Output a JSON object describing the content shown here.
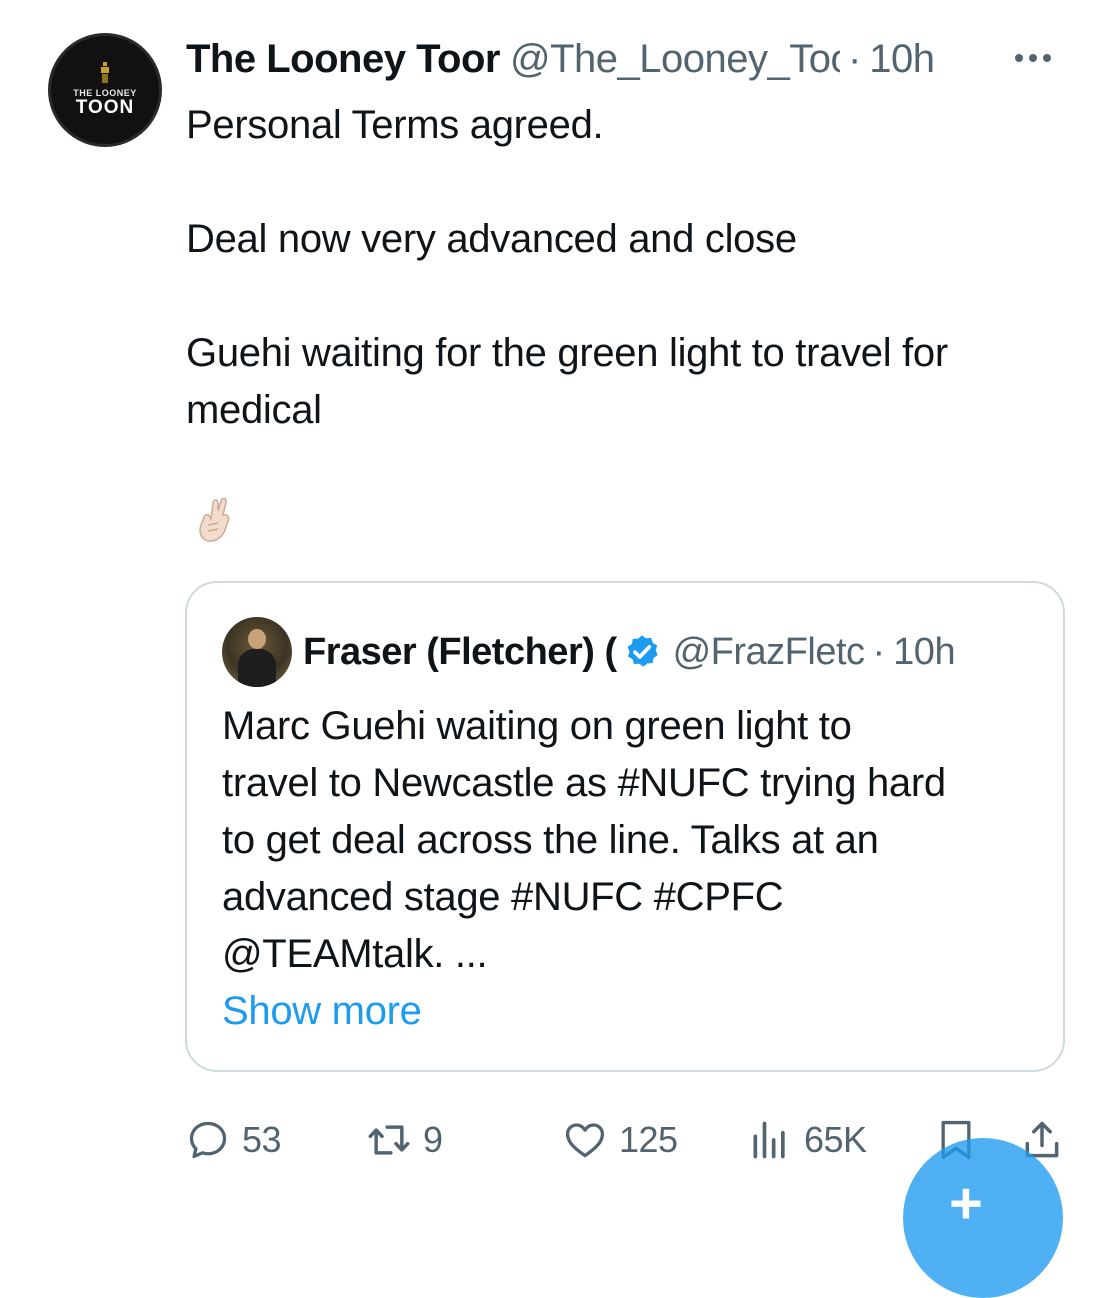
{
  "tweet": {
    "author": {
      "name": "The Looney Toor",
      "handle": "@The_Looney_Toor",
      "avatar_text_small": "THE LOONEY",
      "avatar_text_big": "TOON"
    },
    "separator": "·",
    "time": "10h",
    "text_lines": [
      "Personal Terms agreed.",
      "",
      "Deal now very advanced and close",
      "",
      "Guehi waiting for the green light to travel for",
      "medical"
    ],
    "emoji": "crossed-fingers"
  },
  "quoted_tweet": {
    "author_name": "Fraser (Fletcher) (",
    "verified": true,
    "handle": "@FrazFletc",
    "separator": "·",
    "time": "10h",
    "text_lines": [
      "Marc Guehi waiting on green light to",
      "travel to Newcastle as #NUFC trying hard",
      "to get deal across the line. Talks at an",
      "advanced stage #NUFC #CPFC",
      "@TEAMtalk. ..."
    ],
    "show_more": "Show more"
  },
  "actions": {
    "replies": "53",
    "reposts": "9",
    "likes": "125",
    "views": "65K"
  },
  "colors": {
    "text": "#0f1419",
    "secondary": "#536471",
    "accent": "#1d9bf0",
    "border": "#cfd9de"
  },
  "icons": [
    "reply-icon",
    "repost-icon",
    "like-icon",
    "views-icon",
    "bookmark-icon",
    "share-icon",
    "compose-icon",
    "more-icon",
    "verified-icon"
  ],
  "compose": {
    "label": "+"
  }
}
